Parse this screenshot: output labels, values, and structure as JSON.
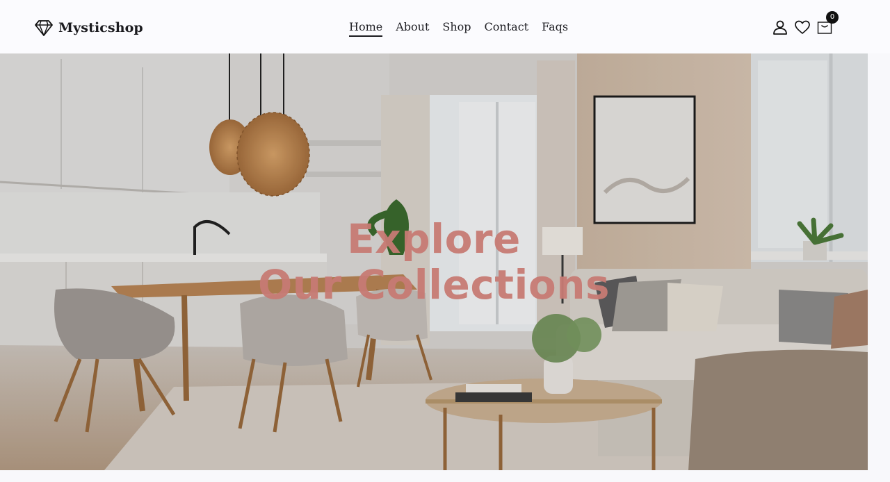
{
  "brand": {
    "name": "Mysticshop",
    "logo_icon": "diamond-icon"
  },
  "nav": {
    "items": [
      {
        "label": "Home",
        "active": true
      },
      {
        "label": "About",
        "active": false
      },
      {
        "label": "Shop",
        "active": false
      },
      {
        "label": "Contact",
        "active": false
      },
      {
        "label": "Faqs",
        "active": false
      }
    ]
  },
  "tools": {
    "account_icon": "user-icon",
    "wishlist_icon": "heart-icon",
    "cart_icon": "shopping-bag-icon",
    "cart_count": "0"
  },
  "hero": {
    "title_line1": "Explore",
    "title_line2": "Our Collections",
    "title_color": "#c77b74",
    "image": "living-room-dining-interior-photo"
  }
}
